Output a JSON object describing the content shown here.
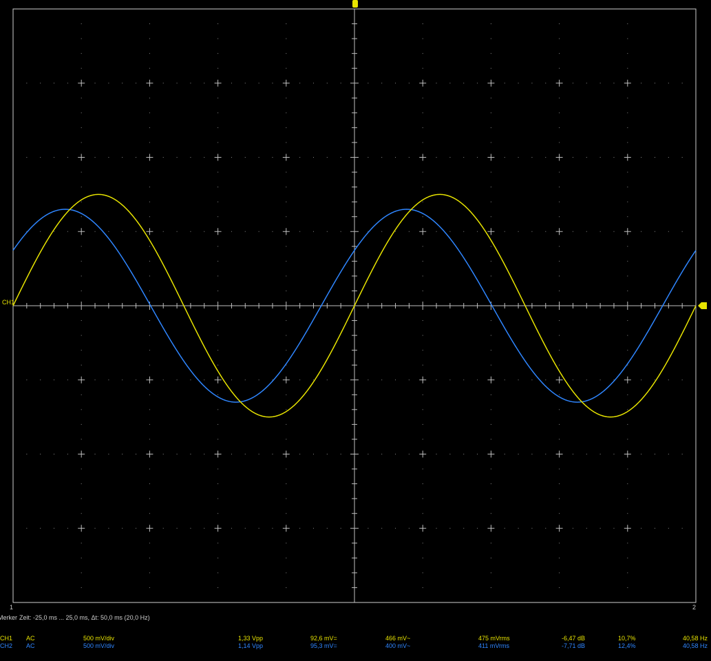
{
  "colors": {
    "ch1": "#e8e400",
    "ch2": "#2f86ff",
    "grid": "#bfbfbf",
    "background": "#000000"
  },
  "channel_label": "CH1",
  "marker_left": "1",
  "marker_right": "2",
  "marker_info": {
    "label": "Merker",
    "text": "Zeit: -25,0 ms ... 25,0 ms,  Δt: 50,0 ms (20,0 Hz)"
  },
  "measurements": [
    {
      "channel": "CH1",
      "coupling": "AC",
      "scale": "500 mV/div",
      "vpp": "1,33 Vpp",
      "dc": "92,6 mV=",
      "ac": "466 mV~",
      "rms": "475 mVrms",
      "db": "-6,47 dB",
      "percent": "10,7%",
      "freq": "40,58 Hz"
    },
    {
      "channel": "CH2",
      "coupling": "AC",
      "scale": "500 mV/div",
      "vpp": "1,14 Vpp",
      "dc": "95,3 mV=",
      "ac": "400 mV~",
      "rms": "411 mVrms",
      "db": "-7,71 dB",
      "percent": "12,4%",
      "freq": "40,58 Hz"
    }
  ],
  "chart_data": {
    "type": "line",
    "grid": true,
    "x_divisions": 10,
    "y_divisions": 8,
    "xlim": [
      -25,
      25
    ],
    "ylim": [
      -2000,
      2000
    ],
    "series": [
      {
        "channel": "CH1",
        "amplitude": 750,
        "period": 25,
        "phase_deg": 0,
        "color": "#e8e400"
      },
      {
        "channel": "CH2",
        "amplitude": 650,
        "period": 25,
        "phase_deg": 35,
        "color": "#2f86ff"
      }
    ]
  }
}
